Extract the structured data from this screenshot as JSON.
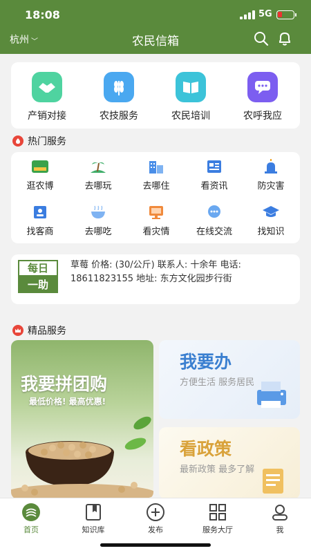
{
  "status": {
    "time": "18:08",
    "network": "5G"
  },
  "header": {
    "city": "杭州",
    "title": "农民信箱"
  },
  "categories": [
    {
      "label": "产销对接",
      "icon": "handshake-icon",
      "color": "#4fd3a0"
    },
    {
      "label": "农技服务",
      "icon": "wheat-icon",
      "color": "#4aa8f0"
    },
    {
      "label": "农民培训",
      "icon": "book-icon",
      "color": "#3cc3d9"
    },
    {
      "label": "农呼我应",
      "icon": "chat-icon",
      "color": "#7c5ef0"
    }
  ],
  "hot": {
    "title": "热门服务",
    "items": [
      {
        "label": "逛农博",
        "icon": "expo-icon"
      },
      {
        "label": "去哪玩",
        "icon": "island-icon"
      },
      {
        "label": "去哪住",
        "icon": "building-icon"
      },
      {
        "label": "看资讯",
        "icon": "news-icon"
      },
      {
        "label": "防灾害",
        "icon": "alarm-icon"
      },
      {
        "label": "找客商",
        "icon": "contact-card-icon"
      },
      {
        "label": "去哪吃",
        "icon": "bowl-icon"
      },
      {
        "label": "看灾情",
        "icon": "monitor-icon"
      },
      {
        "label": "在线交流",
        "icon": "chat-bubble-icon"
      },
      {
        "label": "找知识",
        "icon": "graduation-cap-icon"
      }
    ]
  },
  "notice": {
    "badge_top": "每日",
    "badge_bottom": "一助",
    "text": "草莓 价格: (30/公斤) 联系人: 十余年 电话: 18611823155 地址: 东方文化园步行街"
  },
  "featured": {
    "title": "精品服务",
    "promo": {
      "title": "我要拼团购",
      "subtitle": "最低价格! 最高优惠!"
    },
    "panes": [
      {
        "title": "我要办",
        "subtitle": "方便生活 服务居民",
        "color": "#3a7fd0"
      },
      {
        "title": "看政策",
        "subtitle": "最新政策 最多了解",
        "color": "#d9a23a"
      }
    ]
  },
  "tabs": [
    {
      "label": "首页",
      "icon": "home-icon",
      "active": true
    },
    {
      "label": "知识库",
      "icon": "book-icon"
    },
    {
      "label": "发布",
      "icon": "plus-circle-icon"
    },
    {
      "label": "服务大厅",
      "icon": "grid-icon"
    },
    {
      "label": "我",
      "icon": "profile-icon"
    }
  ],
  "colors": {
    "brand": "#5a8a3c",
    "accent_red": "#e8463a"
  }
}
